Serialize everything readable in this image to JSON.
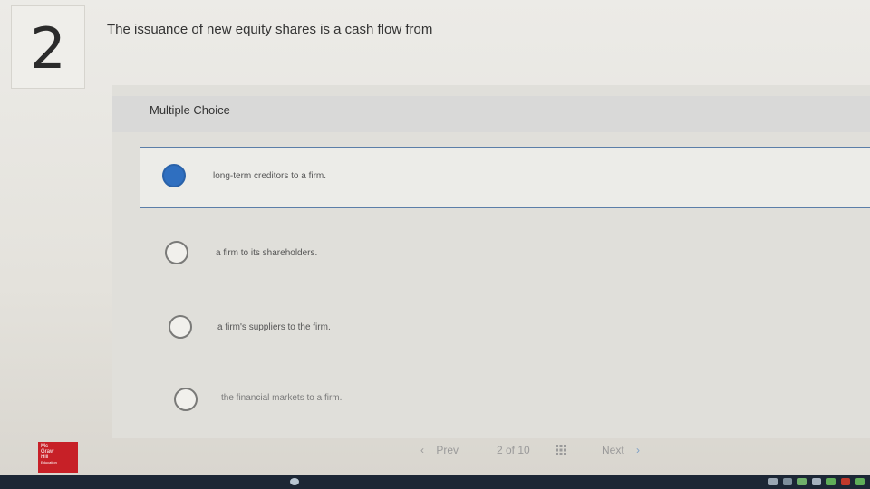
{
  "question": {
    "number": "2",
    "text": "The issuance of new equity shares is a cash flow from"
  },
  "section": {
    "title": "Multiple Choice"
  },
  "options": [
    {
      "label": "long-term creditors to a firm.",
      "selected": true
    },
    {
      "label": "a firm to its shareholders.",
      "selected": false
    },
    {
      "label": "a firm's suppliers to the firm.",
      "selected": false
    },
    {
      "label": "the financial markets to a firm.",
      "selected": false
    }
  ],
  "navigation": {
    "prev_label": "Prev",
    "page_indicator": "2 of 10",
    "next_label": "Next"
  },
  "logo": {
    "lines": [
      "Mc",
      "Graw",
      "Hill",
      "Education"
    ]
  },
  "colors": {
    "selected_radio": "#2f6fc0",
    "logo_red": "#c72027",
    "selected_border": "#5b7ea8"
  }
}
